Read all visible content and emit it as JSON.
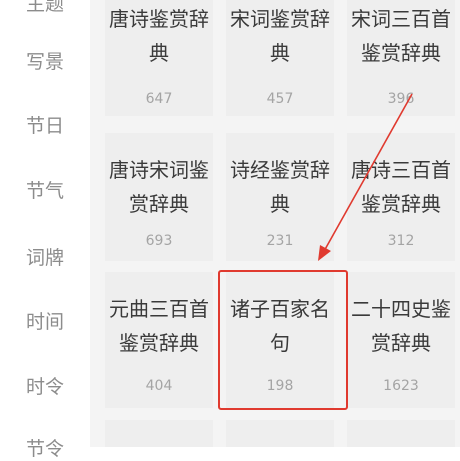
{
  "sidebar": {
    "items": [
      {
        "label": "主题"
      },
      {
        "label": "写景"
      },
      {
        "label": "节日"
      },
      {
        "label": "节气"
      },
      {
        "label": "词牌"
      },
      {
        "label": "时间"
      },
      {
        "label": "时令"
      },
      {
        "label": "节令"
      }
    ]
  },
  "grid": {
    "cards": [
      {
        "line1": "唐诗鉴赏辞",
        "line2": "典",
        "count": "647"
      },
      {
        "line1": "宋词鉴赏辞",
        "line2": "典",
        "count": "457"
      },
      {
        "line1": "宋词三百首",
        "line2": "鉴赏辞典",
        "count": "396"
      },
      {
        "line1": "唐诗宋词鉴",
        "line2": "赏辞典",
        "count": "693"
      },
      {
        "line1": "诗经鉴赏辞",
        "line2": "典",
        "count": "231"
      },
      {
        "line1": "唐诗三百首",
        "line2": "鉴赏辞典",
        "count": "312"
      },
      {
        "line1": "元曲三百首",
        "line2": "鉴赏辞典",
        "count": "404"
      },
      {
        "line1": "诸子百家名",
        "line2": "句",
        "count": "198"
      },
      {
        "line1": "二十四史鉴",
        "line2": "赏辞典",
        "count": "1623"
      }
    ]
  },
  "annotation": {
    "highlight_color": "#e03a2f",
    "highlighted_card": "诸子百家名句"
  }
}
